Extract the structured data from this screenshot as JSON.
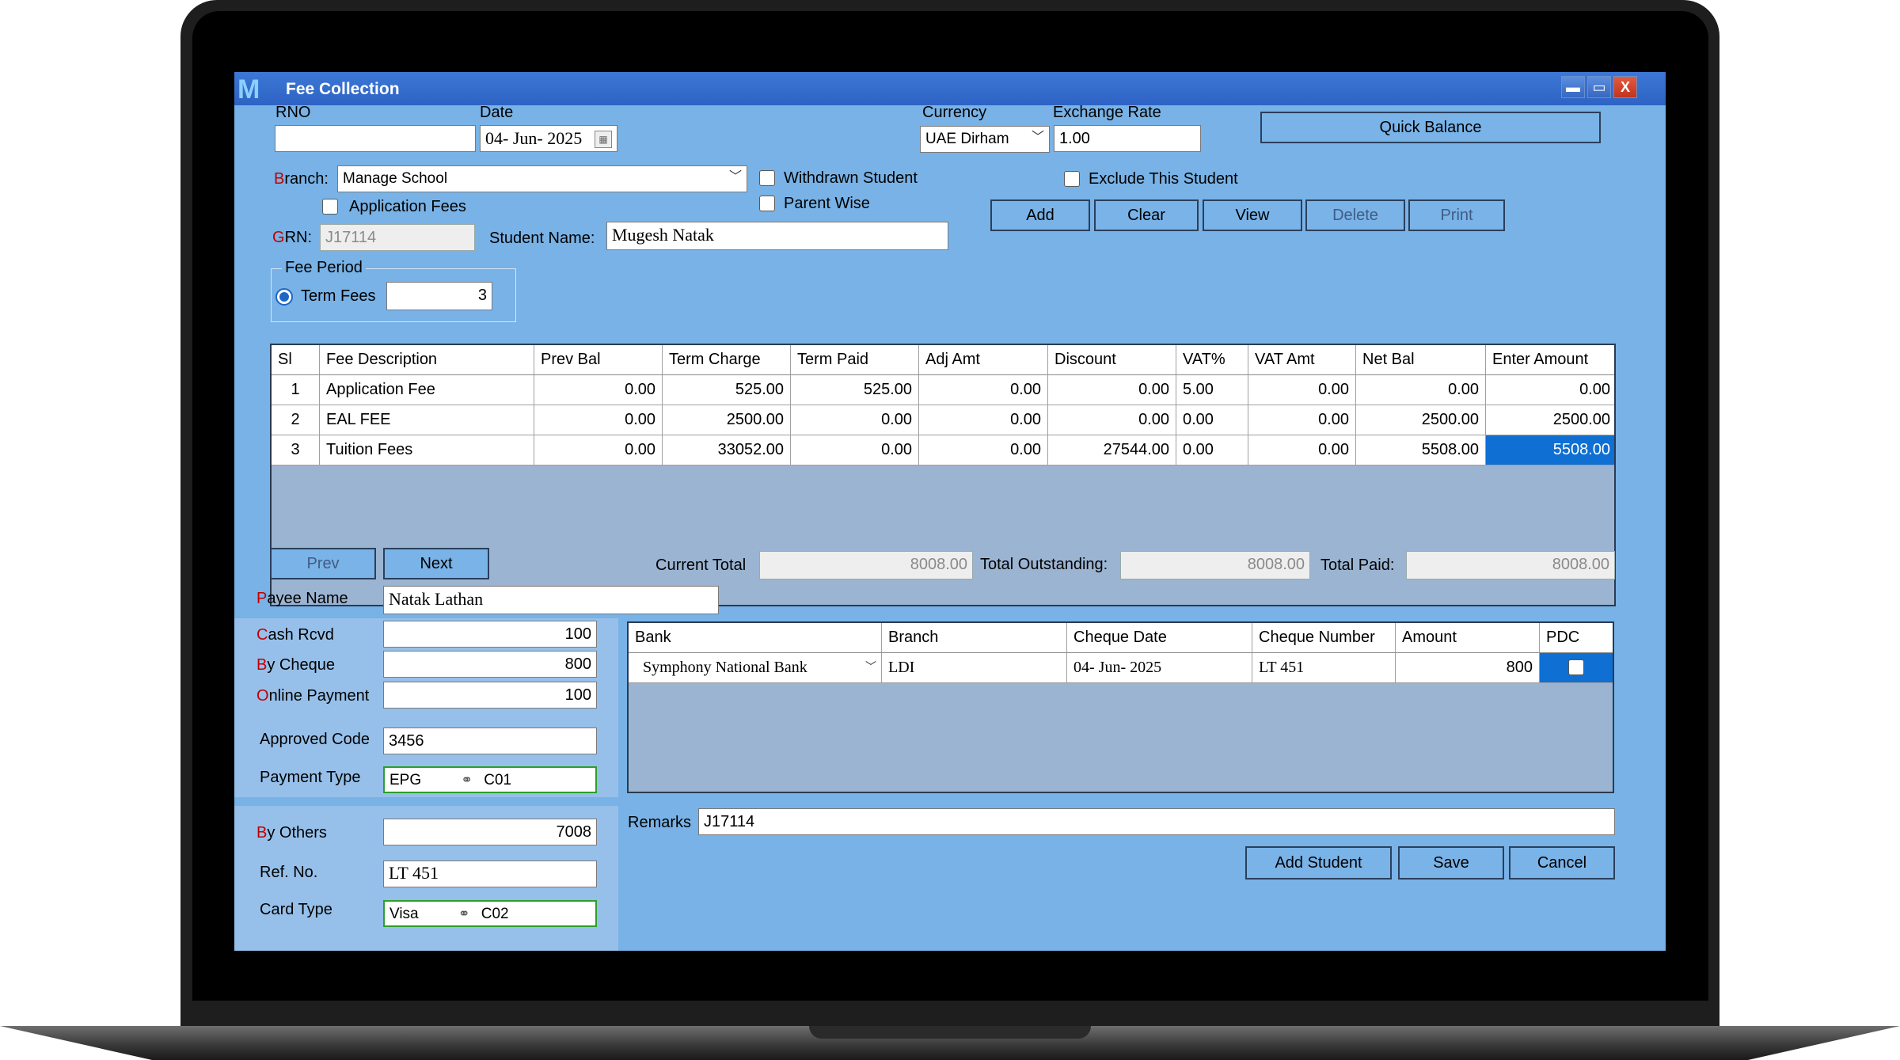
{
  "window": {
    "title": "Fee Collection",
    "minimize": "▬",
    "maximize": "▭",
    "close": "X"
  },
  "rno": {
    "label": "RNO",
    "value": ""
  },
  "date": {
    "label": "Date",
    "value": "04- Jun- 2025"
  },
  "currency": {
    "label": "Currency",
    "value": "UAE Dirham"
  },
  "exchange_rate": {
    "label": "Exchange Rate",
    "value": "1.00"
  },
  "quick_balance": "Quick Balance",
  "branch": {
    "label_first": "B",
    "label_rest": "ranch:",
    "value": "Manage School"
  },
  "withdrawn_student": "Withdrawn Student",
  "parent_wise": "Parent Wise",
  "application_fees": "Application Fees",
  "exclude_student": "Exclude This Student",
  "actions": {
    "add": "Add",
    "clear": "Clear",
    "view": "View",
    "delete": "Delete",
    "print": "Print"
  },
  "grn": {
    "label_first": "G",
    "label_rest": "RN:",
    "value": "J17114"
  },
  "student_name": {
    "label": "Student Name:",
    "value": "Mugesh Natak"
  },
  "fee_period": {
    "legend": "Fee Period",
    "option": "Term Fees",
    "value": "3"
  },
  "fee_table": {
    "headers": [
      "Sl",
      "Fee Description",
      "Prev Bal",
      "Term Charge",
      "Term Paid",
      "Adj Amt",
      "Discount",
      "VAT%",
      "VAT Amt",
      "Net Bal",
      "Enter Amount"
    ],
    "rows": [
      [
        "1",
        "Application Fee",
        "0.00",
        "525.00",
        "525.00",
        "0.00",
        "0.00",
        "5.00",
        "0.00",
        "0.00",
        "0.00"
      ],
      [
        "2",
        "EAL FEE",
        "0.00",
        "2500.00",
        "0.00",
        "0.00",
        "0.00",
        "0.00",
        "0.00",
        "2500.00",
        "2500.00"
      ],
      [
        "3",
        "Tuition Fees",
        "0.00",
        "33052.00",
        "0.00",
        "0.00",
        "27544.00",
        "0.00",
        "0.00",
        "5508.00",
        "5508.00"
      ]
    ]
  },
  "nav": {
    "prev": "Prev",
    "next": "Next"
  },
  "totals": {
    "current_label": "Current Total",
    "current": "8008.00",
    "outstanding_label": "Total Outstanding:",
    "outstanding": "8008.00",
    "paid_label": "Total Paid:",
    "paid": "8008.00"
  },
  "payee": {
    "label_first": "P",
    "label_rest": "ayee   Name",
    "value": "Natak Lathan"
  },
  "cash": {
    "label_first": "C",
    "label_rest": "ash Rcvd",
    "value": "100"
  },
  "cheque": {
    "label_first": "B",
    "label_rest": "y Cheque",
    "value": "800"
  },
  "online": {
    "label_first": "O",
    "label_rest": "nline Payment",
    "value": "100"
  },
  "approved_code": {
    "label": "Approved Code",
    "value": "3456"
  },
  "payment_type": {
    "label": "Payment Type",
    "value": "EPG",
    "code": "C01"
  },
  "by_others": {
    "label_first": "B",
    "label_rest": "y Others",
    "value": "7008"
  },
  "ref_no": {
    "label": "Ref. No.",
    "value": "LT 451"
  },
  "card_type": {
    "label": "Card Type",
    "value": "Visa",
    "code": "C02"
  },
  "cheque_table": {
    "headers": [
      "Bank",
      "Branch",
      "Cheque Date",
      "Cheque Number",
      "Amount",
      "PDC"
    ],
    "row": [
      "Symphony National Bank",
      "LDI",
      "04- Jun- 2025",
      "LT 451",
      "800"
    ]
  },
  "remarks": {
    "label": "Remarks",
    "value": "J17114"
  },
  "bottom": {
    "add_student": "Add Student",
    "save": "Save",
    "cancel": "Cancel"
  }
}
